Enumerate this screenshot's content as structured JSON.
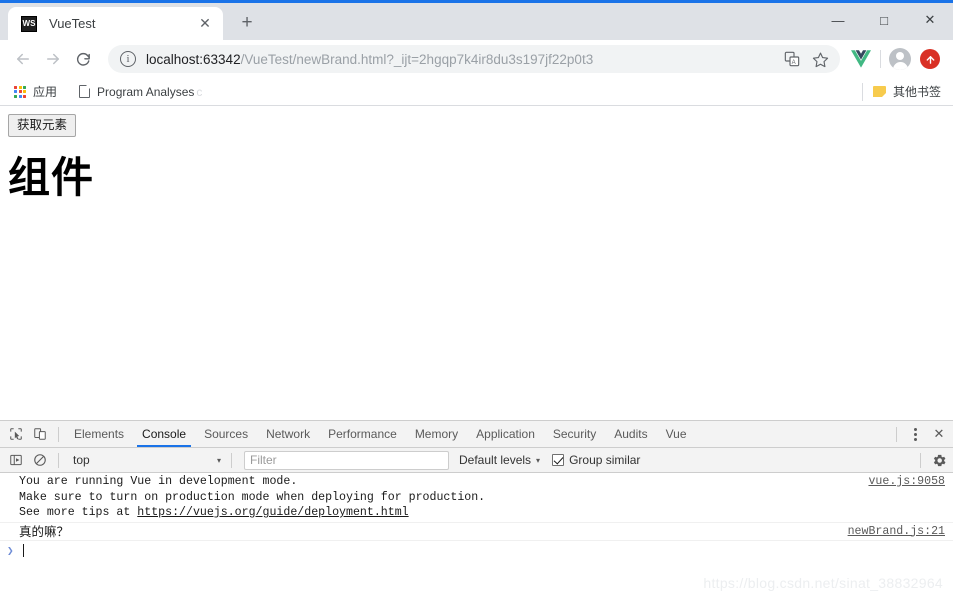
{
  "window": {
    "minimize_label": "—",
    "maximize_label": "□",
    "close_label": "✕"
  },
  "tabstrip": {
    "tab": {
      "favicon_text": "WS",
      "title": "VueTest",
      "close_label": "✕"
    },
    "new_tab_label": "+"
  },
  "toolbar": {
    "back_label": "←",
    "forward_label": "→",
    "reload_label": "⟳",
    "info_label": "i",
    "url_host": "localhost:63342",
    "url_path": "/VueTest/newBrand.html?_ijt=2hgqp7k4ir8du3s197jf22p0t3",
    "url_full": "localhost:63342/VueTest/newBrand.html?_ijt=2hgqp7k4ir8du3s197jf22p0t3",
    "translate_icon": "translate-icon",
    "bookmark_star_label": "☆",
    "vue_devtools_icon": "vue-icon",
    "profile_icon": "avatar-icon",
    "update_badge_label": "⬆",
    "update_badge_color": "#d93025"
  },
  "bookmarks": {
    "apps_label": "应用",
    "apps_colors": [
      "#ea4335",
      "#fbbc04",
      "#34a853",
      "#4285f4",
      "#ea4335",
      "#fbbc04",
      "#34a853",
      "#4285f4",
      "#ea4335"
    ],
    "items": [
      {
        "label": "Program Analyses",
        "truncation": "c"
      }
    ],
    "other_bookmarks_label": "其他书签"
  },
  "page": {
    "button_label": "获取元素",
    "heading": "组件"
  },
  "devtools": {
    "inspect_icon": "inspect-element-icon",
    "device_icon": "device-toolbar-icon",
    "tabs": [
      {
        "label": "Elements",
        "active": false
      },
      {
        "label": "Console",
        "active": true
      },
      {
        "label": "Sources",
        "active": false
      },
      {
        "label": "Network",
        "active": false
      },
      {
        "label": "Performance",
        "active": false
      },
      {
        "label": "Memory",
        "active": false
      },
      {
        "label": "Application",
        "active": false
      },
      {
        "label": "Security",
        "active": false
      },
      {
        "label": "Audits",
        "active": false
      },
      {
        "label": "Vue",
        "active": false
      }
    ],
    "active_tab_color": "#1a73e8",
    "more_label": "more-options-icon",
    "close_label": "✕",
    "console_toolbar": {
      "sidebar_toggle_icon": "console-sidebar-icon",
      "clear_icon": "clear-console-icon",
      "context": "top",
      "context_caret": "▾",
      "filter_placeholder": "Filter",
      "levels_label": "Default levels",
      "levels_caret": "▾",
      "group_similar_label": "Group similar",
      "group_similar_checked": true,
      "settings_icon": "settings-gear-icon"
    },
    "messages": [
      {
        "lines": [
          "You are running Vue in development mode.",
          "Make sure to turn on production mode when deploying for production.",
          "See more tips at "
        ],
        "link_text": "https://vuejs.org/guide/deployment.html",
        "source": "vue.js:9058",
        "cjk": false
      },
      {
        "lines": [
          "真的嘛？"
        ],
        "link_text": "",
        "source": "newBrand.js:21",
        "cjk": true
      }
    ],
    "prompt_arrow": "❯"
  },
  "watermark": "https://blog.csdn.net/sinat_38832964"
}
